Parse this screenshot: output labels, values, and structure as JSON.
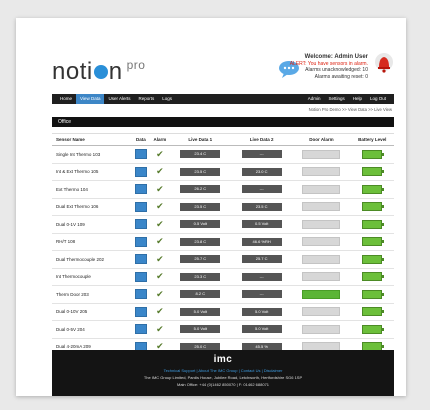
{
  "header": {
    "logo": "noti",
    "logo_end": "n",
    "logo_pro": "pro",
    "welcome": "Welcome: Admin User",
    "alert": "ALERT: You have sensors in alarm.",
    "unacknowledged": "Alarms unacknowledged: 10",
    "awaiting_reset": "Alarms awaiting reset: 0"
  },
  "nav": {
    "home": "Home",
    "view_data": "View Data",
    "user_alerts": "User Alerts",
    "reports": "Reports",
    "logs": "Logs",
    "admin": "Admin",
    "settings": "Settings",
    "help": "Help",
    "logout": "Log Out"
  },
  "breadcrumb": "Notion Pro Demo >> View Data >> Live View",
  "section_title": "Office",
  "table": {
    "headers": [
      "Sensor Name",
      "Data",
      "Alarm",
      "Live Data 1",
      "Live Data 2",
      "Door Alarm",
      "Battery Level"
    ],
    "rows": [
      {
        "name": "Single Int Thermo 103",
        "d1": "23.4 C",
        "d2": "---",
        "door": "off"
      },
      {
        "name": "Int & Ext Thermo 105",
        "d1": "23.5 C",
        "d2": "23.0 C",
        "door": "off"
      },
      {
        "name": "Ext Thermo 104",
        "d1": "26.2 C",
        "d2": "---",
        "door": "off"
      },
      {
        "name": "Dual Ext Thermo 106",
        "d1": "23.5 C",
        "d2": "23.5 C",
        "door": "off"
      },
      {
        "name": "Dual 0-1V 109",
        "d1": "0.5 Volt",
        "d2": "0.5 Volt",
        "door": "off"
      },
      {
        "name": "RH/T 108",
        "d1": "23.8 C",
        "d2": "46.6 %RH",
        "door": "off"
      },
      {
        "name": "Dual Thermocouple 202",
        "d1": "25.7 C",
        "d2": "25.7 C",
        "door": "off"
      },
      {
        "name": "Int Thermocouple",
        "d1": "23.3 C",
        "d2": "---",
        "door": "off"
      },
      {
        "name": "Therm Door 203",
        "d1": "8.2 C",
        "d2": "---",
        "door": "on"
      },
      {
        "name": "Dual 0-10V 205",
        "d1": "5.0 Volt",
        "d2": "5.0 Volt",
        "door": "off"
      },
      {
        "name": "Dual 0-5V 204",
        "d1": "5.0 Volt",
        "d2": "5.0 Volt",
        "door": "off"
      },
      {
        "name": "Dual 4-20mA 209",
        "d1": "25.0 C",
        "d2": "45.5 %",
        "door": "off"
      }
    ]
  },
  "footer": {
    "logo": "imc",
    "links": "Technical Support | About The IMC Group | Contact Us | Disclaimer",
    "address": "The IMC Group Limited, Pardis House, Jubilee Road, Letchworth, Hertfordshire SG6 1SP",
    "phone": "Main Office: +44 (0)1462 850070 | F: 01462 688071"
  },
  "colors": {
    "nav_bg": "#1f1f1f",
    "nav_active": "#3d86c6",
    "alert_red": "#dd2211",
    "battery_green": "#6cbf3a",
    "door_on": "#5bb536"
  }
}
